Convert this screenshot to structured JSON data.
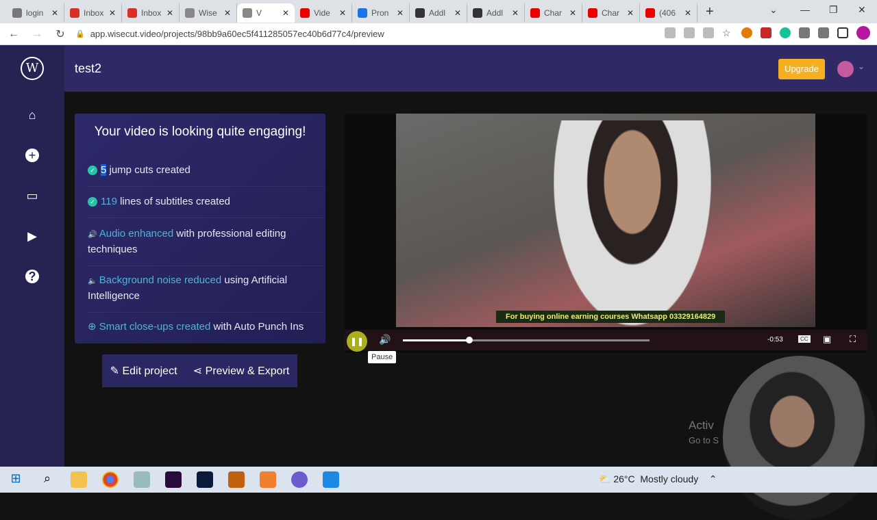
{
  "browser": {
    "tabs": [
      {
        "label": "login",
        "color": "#777"
      },
      {
        "label": "Inbox",
        "color": "#d93025"
      },
      {
        "label": "Inbox",
        "color": "#d93025"
      },
      {
        "label": "Wise",
        "color": "#888"
      },
      {
        "label": "V",
        "color": "#888",
        "active": true
      },
      {
        "label": "Vide",
        "color": "#e00"
      },
      {
        "label": "Pron",
        "color": "#1a73e8"
      },
      {
        "label": "Addl",
        "color": "#333"
      },
      {
        "label": "Addl",
        "color": "#333"
      },
      {
        "label": "Char",
        "color": "#e00"
      },
      {
        "label": "Char",
        "color": "#e00"
      },
      {
        "label": "(406",
        "color": "#e00"
      }
    ],
    "new_tab": "+",
    "url": "app.wisecut.video/projects/98bb9a60ec5f411285057ec40b6d77c4/preview"
  },
  "app": {
    "logo": "W",
    "project_title": "test2",
    "upgrade_label": "Upgrade",
    "sidebar": [
      "home-icon",
      "add-icon",
      "folder-icon",
      "video-library-icon",
      "help-icon"
    ],
    "summary": {
      "heading": "Your video is looking quite engaging!",
      "items": [
        {
          "highlight": "5",
          "text": " jump cuts created"
        },
        {
          "highlight": "119",
          "text": " lines of subtitles created"
        },
        {
          "highlight": "Audio enhanced",
          "text": " with professional editing techniques"
        },
        {
          "highlight": "Background noise reduced",
          "text": " using Artificial Intelligence"
        },
        {
          "highlight": "Smart close-ups created",
          "text": " with Auto Punch Ins"
        }
      ]
    },
    "actions": {
      "edit": "Edit project",
      "export": "Preview & Export"
    },
    "player": {
      "subtitle": "For buying online earning courses Whatsapp 03329164829",
      "time_remaining": "-0:53",
      "cc": "CC",
      "progress_percent": 27,
      "tooltip": "Pause"
    }
  },
  "watermark": {
    "line1": "Activ",
    "line2": "Go to S"
  },
  "taskbar": {
    "weather_temp": "26°C",
    "weather_text": "Mostly cloudy"
  }
}
